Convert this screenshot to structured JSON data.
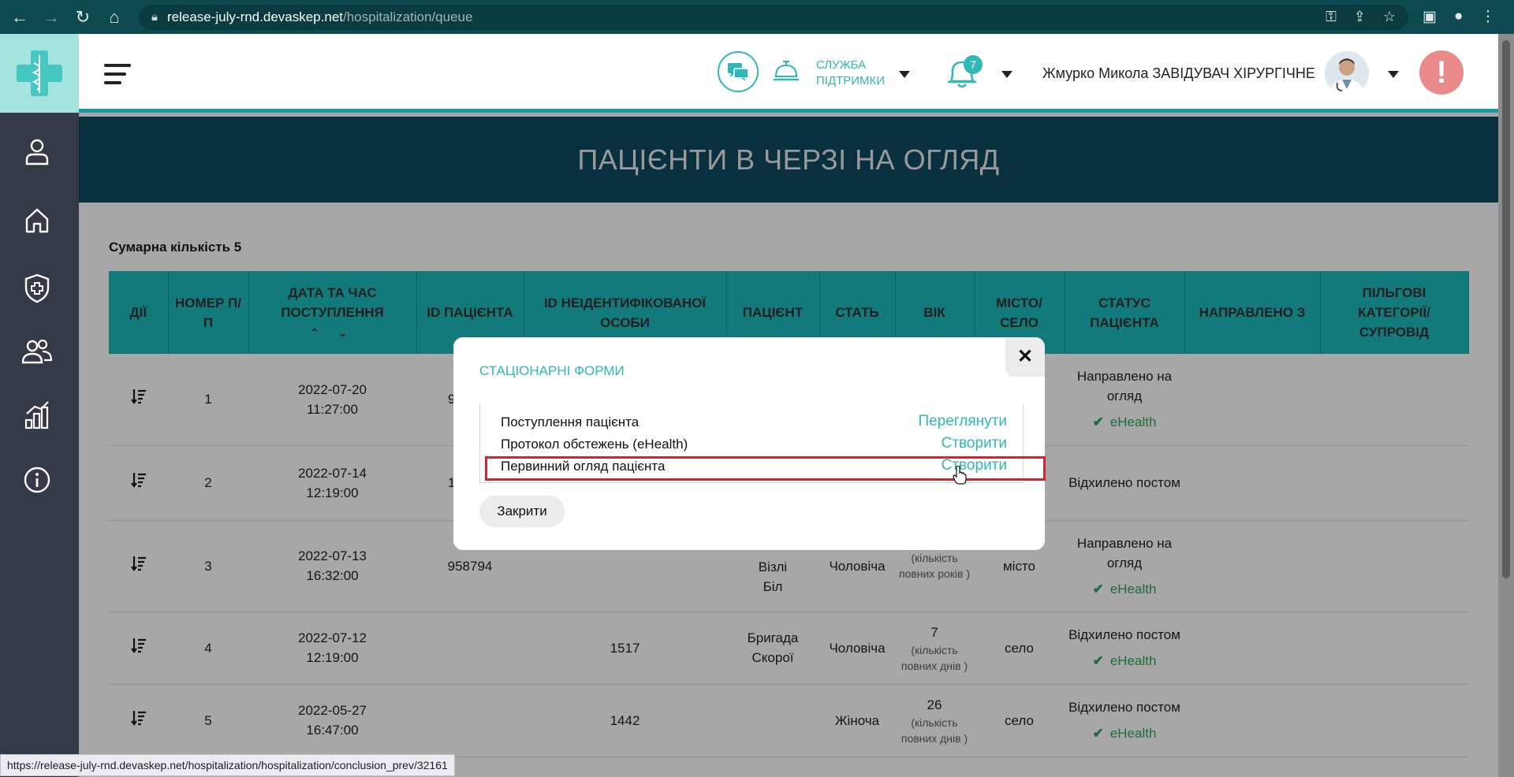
{
  "browser": {
    "url_host": "release-july-rnd.devaskep.net",
    "url_path": "/hospitalization/queue",
    "nav_icons": [
      "back-icon",
      "forward-icon",
      "reload-icon",
      "home-icon"
    ],
    "status_url": "https://release-july-rnd.devaskep.net/hospitalization/hospitalization/conclusion_prev/32161"
  },
  "sidebar": {
    "items": [
      "user-icon",
      "home-icon",
      "shield-cross-icon",
      "patients-icon",
      "stats-icon",
      "info-icon"
    ]
  },
  "header": {
    "support_label_1": "СЛУЖБА",
    "support_label_2": "ПІДТРИМКИ",
    "notification_count": "7",
    "user_name": "Жмурко Микола ЗАВІДУВАЧ ХІРУРГІЧНЕ",
    "alert_symbol": "!"
  },
  "page": {
    "title": "ПАЦІЄНТИ В ЧЕРЗІ НА ОГЛЯД",
    "total": "Сумарна кількість 5"
  },
  "table": {
    "headers": [
      "ДІЇ",
      "НОМЕР П/П",
      "ДАТА ТА ЧАС ПОСТУПЛЕННЯ",
      "ID ПАЦІЄНТА",
      "ID НЕІДЕНТИФІКОВАНОЇ ОСОБИ",
      "ПАЦІЄНТ",
      "СТАТЬ",
      "ВІК",
      "МІСТО/ СЕЛО",
      "СТАТУС ПАЦІЄНТА",
      "НАПРАВЛЕНО З",
      "ПІЛЬГОВІ КАТЕГОРІЇ/ СУПРОВІД"
    ],
    "sort_arrows": "⌃ ⌄",
    "rows": [
      {
        "num": "1",
        "date": "2022-07-20",
        "time": "11:27:00",
        "patient_id": "9",
        "unid": "",
        "patient_1": "",
        "patient_2": "",
        "sex": "",
        "age": "",
        "age_unit": "",
        "place": "",
        "status": "Направлено на огляд",
        "ehealth": "eHealth"
      },
      {
        "num": "2",
        "date": "2022-07-14",
        "time": "12:19:00",
        "patient_id": "1",
        "unid": "",
        "patient_1": "",
        "patient_2": "",
        "sex": "",
        "age": "",
        "age_unit": "",
        "place": "",
        "status": "Відхилено постом",
        "ehealth": ""
      },
      {
        "num": "3",
        "date": "2022-07-13",
        "time": "16:32:00",
        "patient_id": "958794",
        "unid": "",
        "patient_1": "Візлі",
        "patient_2": "Біл",
        "sex": "Чоловіча",
        "age": "",
        "age_unit": "(кількість повних років )",
        "place": "місто",
        "status": "Направлено на огляд",
        "ehealth": "eHealth"
      },
      {
        "num": "4",
        "date": "2022-07-12",
        "time": "12:19:00",
        "patient_id": "",
        "unid": "1517",
        "patient_1": "Бригада",
        "patient_2": "Скорої",
        "sex": "Чоловіча",
        "age": "7",
        "age_unit": "(кількість повних днів )",
        "place": "село",
        "status": "Відхилено постом",
        "ehealth": "eHealth"
      },
      {
        "num": "5",
        "date": "2022-05-27",
        "time": "16:47:00",
        "patient_id": "",
        "unid": "1442",
        "patient_1": "",
        "patient_2": "",
        "sex": "Жіноча",
        "age": "26",
        "age_unit": "(кількість повних днів )",
        "place": "село",
        "status": "Відхилено постом",
        "ehealth": "eHealth"
      }
    ]
  },
  "modal": {
    "title": "СТАЦІОНАРНІ ФОРМИ",
    "close_symbol": "✕",
    "forms": [
      {
        "label": "Поступлення пацієнта",
        "action": "Переглянути"
      },
      {
        "label": "Протокол обстежень (eHealth)",
        "action": "Створити"
      },
      {
        "label": "Первинний огляд пацієнта",
        "action": "Створити"
      }
    ],
    "close_label": "Закрити"
  },
  "colors": {
    "teal": "#2fb8b5",
    "header_row": "#137a7c",
    "banner": "#09303f",
    "sidebar": "#343a48",
    "highlight": "#d6232a"
  }
}
